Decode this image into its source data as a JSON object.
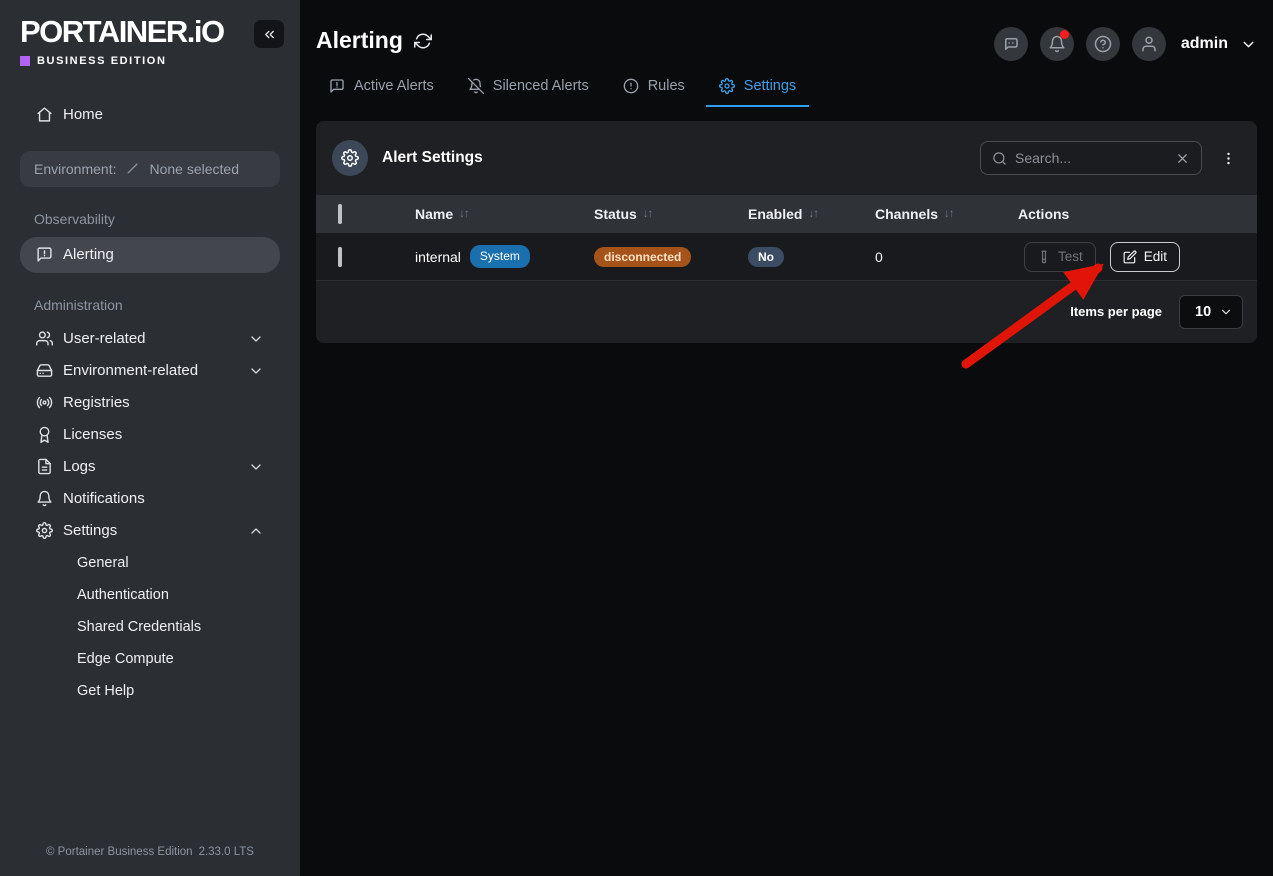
{
  "brand": {
    "logo_text": "PORTAINER.iO",
    "edition_label": "BUSINESS EDITION",
    "footer_copyright": "© Portainer Business Edition",
    "footer_version": "2.33.0 LTS"
  },
  "sidebar": {
    "home_label": "Home",
    "environment_prefix": "Environment:",
    "environment_value": "None selected",
    "section_observability": "Observability",
    "alerting_label": "Alerting",
    "section_administration": "Administration",
    "nav": [
      {
        "label": "User-related"
      },
      {
        "label": "Environment-related"
      },
      {
        "label": "Registries"
      },
      {
        "label": "Licenses"
      },
      {
        "label": "Logs"
      },
      {
        "label": "Notifications"
      },
      {
        "label": "Settings"
      }
    ],
    "settings_children": [
      "General",
      "Authentication",
      "Shared Credentials",
      "Edge Compute",
      "Get Help"
    ]
  },
  "header": {
    "title": "Alerting",
    "username": "admin"
  },
  "tabs": [
    {
      "label": "Active Alerts"
    },
    {
      "label": "Silenced Alerts"
    },
    {
      "label": "Rules"
    },
    {
      "label": "Settings"
    }
  ],
  "panel": {
    "title": "Alert Settings",
    "search_placeholder": "Search...",
    "columns": [
      "Name",
      "Status",
      "Enabled",
      "Channels",
      "Actions"
    ],
    "row": {
      "name": "internal",
      "name_badge": "System",
      "status": "disconnected",
      "enabled": "No",
      "channels": "0",
      "test_label": "Test",
      "edit_label": "Edit"
    },
    "pagination": {
      "label": "Items per page",
      "value": "10"
    }
  },
  "colors": {
    "accent_blue": "#3f9fe9",
    "brand_purple": "#b164f1",
    "badge_system_bg": "#1a6fae",
    "badge_disconnected_bg": "#a5531a",
    "badge_no_bg": "#3c4d63",
    "notification_dot": "#ff1c1c",
    "arrow_red": "#e01507"
  }
}
